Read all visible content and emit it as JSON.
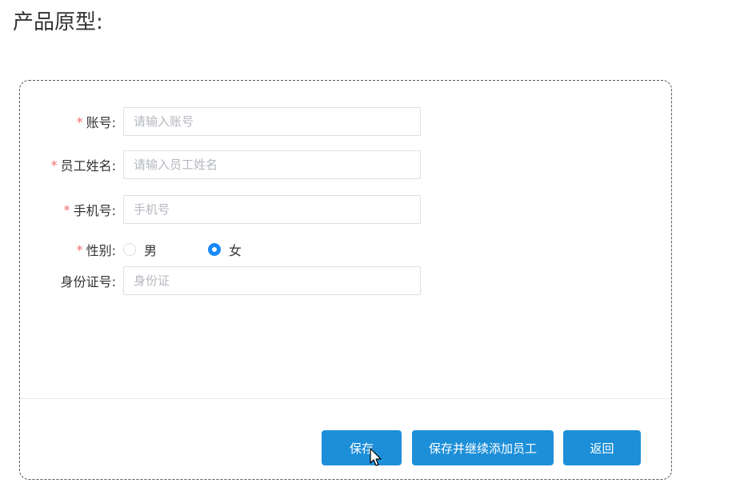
{
  "page": {
    "title": "产品原型:"
  },
  "form": {
    "fields": [
      {
        "label": "账号:",
        "required_mark": "*",
        "placeholder": "请输入账号",
        "value": ""
      },
      {
        "label": "员工姓名:",
        "required_mark": "*",
        "placeholder": "请输入员工姓名",
        "value": ""
      },
      {
        "label": "手机号:",
        "required_mark": "*",
        "placeholder": "手机号",
        "value": ""
      }
    ],
    "gender": {
      "label": "性别:",
      "required_mark": "*",
      "options": [
        {
          "label": "男",
          "checked": false
        },
        {
          "label": "女",
          "checked": true
        }
      ]
    },
    "id_card": {
      "label": "身份证号:",
      "placeholder": "身份证",
      "value": ""
    }
  },
  "actions": {
    "save": "保存",
    "save_and_continue": "保存并继续添加员工",
    "back": "返回"
  },
  "colors": {
    "primary_button": "#1d8fd8",
    "required_mark": "#f56c6c",
    "radio_checked": "#1989fa"
  }
}
